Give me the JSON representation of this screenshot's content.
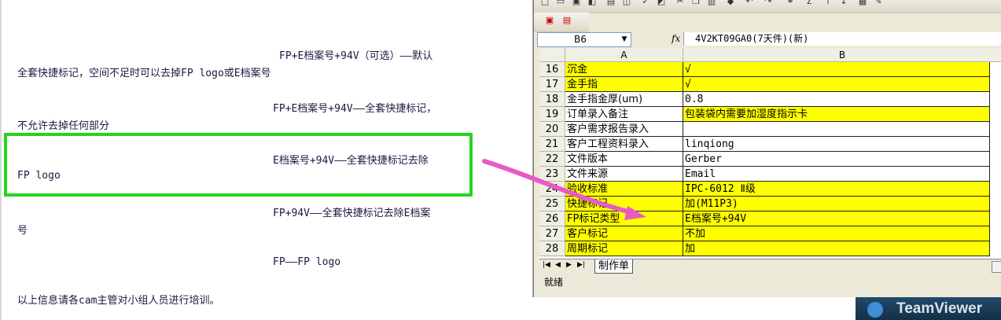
{
  "document": {
    "lines": [
      "FP+E档案号+94V（可选）——默认",
      "全套快捷标记，空间不足时可以去掉FP logo或E档案号",
      "FP+E档案号+94V——全套快捷标记，",
      "不允许去掉任何部分",
      "E档案号+94V——全套快捷标记去除",
      "FP logo",
      "FP+94V——全套快捷标记去除E档案",
      "号",
      "FP——FP logo",
      "以上信息请各cam主管对小组人员进行培训。"
    ]
  },
  "excel": {
    "name_box": "B6",
    "fx_label": "fx",
    "formula": "4V2KT09GA0(7天件)(新)",
    "col_a": "A",
    "col_b": "B",
    "rows": [
      {
        "n": "16",
        "a": "沉金",
        "b": "√"
      },
      {
        "n": "17",
        "a": "金手指",
        "b": "√"
      },
      {
        "n": "18",
        "a": "金手指金厚(um)",
        "b": "0.8"
      },
      {
        "n": "19",
        "a": "订单录入备注",
        "b": "包装袋内需要加湿度指示卡"
      },
      {
        "n": "20",
        "a": "客户需求报告录入",
        "b": ""
      },
      {
        "n": "21",
        "a": "客户工程资料录入",
        "b": "linqiong"
      },
      {
        "n": "22",
        "a": "文件版本",
        "b": "Gerber"
      },
      {
        "n": "23",
        "a": "文件来源",
        "b": "Email"
      },
      {
        "n": "24",
        "a": "验收标准",
        "b": "IPC-6012 Ⅱ级"
      },
      {
        "n": "25",
        "a": "快捷标记",
        "b": "加(M11P3)"
      },
      {
        "n": "26",
        "a": "FP标记类型",
        "b": "E档案号+94V"
      },
      {
        "n": "27",
        "a": "客户标记",
        "b": "不加"
      },
      {
        "n": "28",
        "a": "周期标记",
        "b": "加"
      }
    ],
    "sheet_tab": "制作单",
    "status": "就绪"
  },
  "teamviewer": {
    "name": "TeamViewer"
  },
  "colors": {
    "highlight_green": "#22d61f",
    "arrow_pink": "#e85bc5",
    "cell_yellow": "#ffff00"
  }
}
